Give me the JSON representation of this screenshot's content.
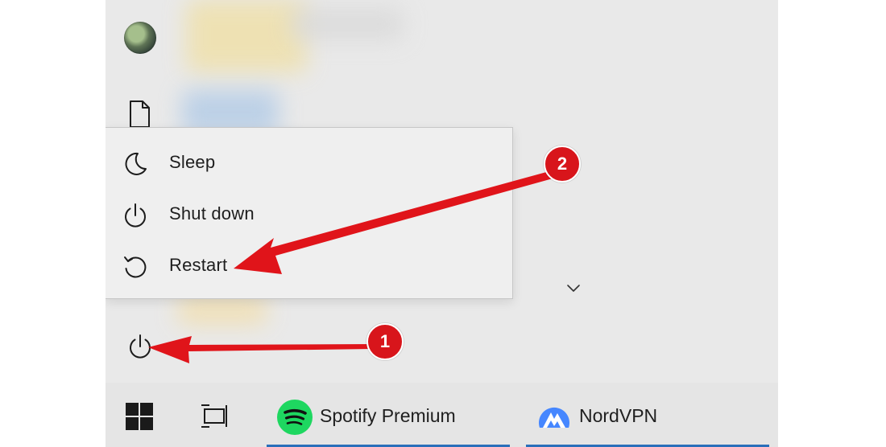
{
  "power_menu": {
    "items": [
      {
        "label": "Sleep",
        "icon": "moon-icon"
      },
      {
        "label": "Shut down",
        "icon": "power-icon"
      },
      {
        "label": "Restart",
        "icon": "restart-icon"
      }
    ]
  },
  "taskbar": {
    "pinned": [
      {
        "label": "Spotify Premium",
        "icon": "spotify-icon",
        "color": "#1ed760"
      },
      {
        "label": "NordVPN",
        "icon": "nordvpn-icon",
        "color": "#4687ff"
      }
    ],
    "start_icon": "windows-logo-icon",
    "task_view_icon": "task-view-icon"
  },
  "annotations": {
    "step1": "1",
    "step2": "2",
    "color": "#d8151b"
  },
  "colors": {
    "accent": "#2a6fba",
    "menu_bg": "#efefef",
    "start_bg": "#e9e9e9"
  }
}
